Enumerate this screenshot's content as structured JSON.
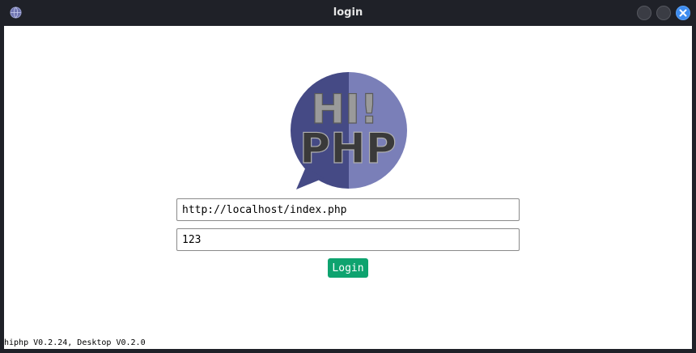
{
  "window": {
    "title": "login",
    "app_icon": "globe-icon",
    "controls": [
      "minimize-button",
      "maximize-button",
      "close-button"
    ],
    "accent": "#3d8cf0"
  },
  "logo": {
    "icon": "hiphp-speech-bubble-logo",
    "line1": "HI!",
    "line2": "PHP",
    "colors": {
      "dark": "#454a85",
      "light": "#7a7fb8",
      "text_top": "#9a9a9a",
      "text_bottom": "#3a3a3a"
    }
  },
  "form": {
    "url_value": "http://localhost/index.php",
    "password_value": "123",
    "login_label": "Login",
    "button_color": "#0ea36f"
  },
  "footer": {
    "version_text": "hiphp V0.2.24, Desktop V0.2.0"
  }
}
